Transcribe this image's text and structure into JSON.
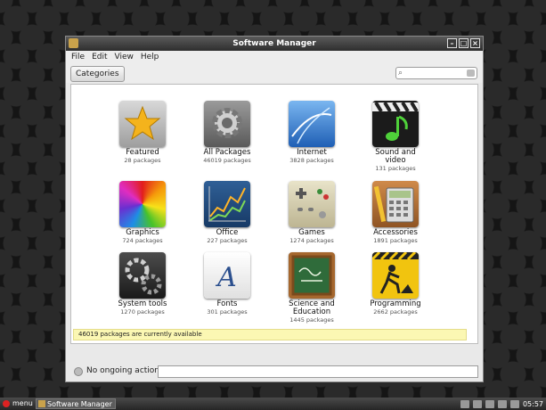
{
  "window": {
    "title": "Software Manager"
  },
  "menubar": [
    "File",
    "Edit",
    "View",
    "Help"
  ],
  "toolbar": {
    "categories_label": "Categories",
    "search_placeholder": ""
  },
  "categories": [
    {
      "name": "Featured",
      "count": "28 packages",
      "icon": "star-icon"
    },
    {
      "name": "All Packages",
      "count": "46019 packages",
      "icon": "gear-icon"
    },
    {
      "name": "Internet",
      "count": "3828 packages",
      "icon": "globe-icon"
    },
    {
      "name": "Sound and\nvideo",
      "count": "131 packages",
      "icon": "music-note-icon"
    },
    {
      "name": "Graphics",
      "count": "724 packages",
      "icon": "color-wheel-icon"
    },
    {
      "name": "Office",
      "count": "227 packages",
      "icon": "chart-icon"
    },
    {
      "name": "Games",
      "count": "1274 packages",
      "icon": "gamepad-icon"
    },
    {
      "name": "Accessories",
      "count": "1891 packages",
      "icon": "calculator-icon"
    },
    {
      "name": "System tools",
      "count": "1270 packages",
      "icon": "gears-icon"
    },
    {
      "name": "Fonts",
      "count": "301 packages",
      "icon": "font-icon"
    },
    {
      "name": "Science and\nEducation",
      "count": "1445 packages",
      "icon": "chalkboard-icon"
    },
    {
      "name": "Programming",
      "count": "2662 packages",
      "icon": "construction-icon"
    }
  ],
  "status": {
    "available": "46019 packages are currently available"
  },
  "bottom": {
    "ongoing": "No ongoing actions"
  },
  "taskbar": {
    "menu_label": "menu",
    "task_label": "Software Manager",
    "clock": "05:57"
  }
}
